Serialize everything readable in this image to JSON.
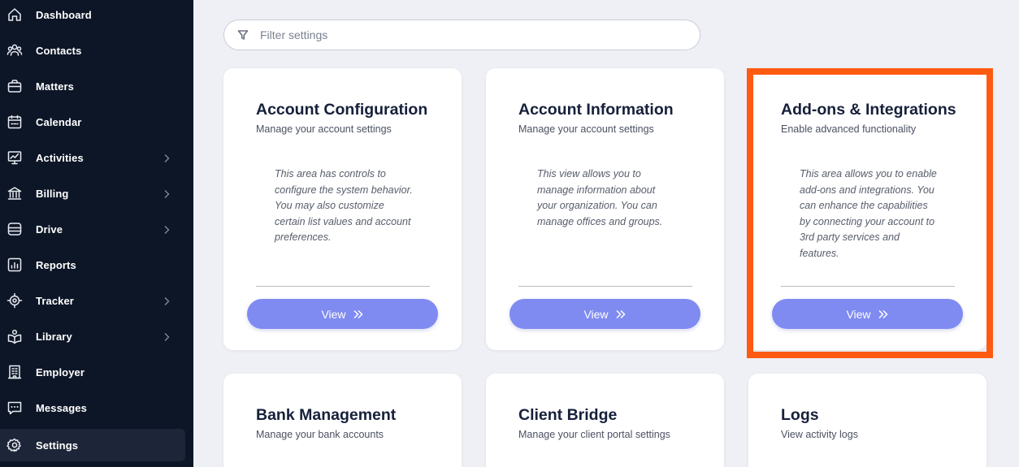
{
  "sidebar": {
    "items": [
      {
        "label": "Dashboard",
        "icon": "home-icon",
        "chevron": false
      },
      {
        "label": "Contacts",
        "icon": "contacts-icon",
        "chevron": false
      },
      {
        "label": "Matters",
        "icon": "briefcase-icon",
        "chevron": false
      },
      {
        "label": "Calendar",
        "icon": "calendar-icon",
        "chevron": false
      },
      {
        "label": "Activities",
        "icon": "activities-icon",
        "chevron": true
      },
      {
        "label": "Billing",
        "icon": "bank-icon",
        "chevron": true
      },
      {
        "label": "Drive",
        "icon": "database-icon",
        "chevron": true
      },
      {
        "label": "Reports",
        "icon": "reports-icon",
        "chevron": false
      },
      {
        "label": "Tracker",
        "icon": "tracker-icon",
        "chevron": true
      },
      {
        "label": "Library",
        "icon": "library-icon",
        "chevron": true
      },
      {
        "label": "Employer",
        "icon": "building-icon",
        "chevron": false
      },
      {
        "label": "Messages",
        "icon": "message-icon",
        "chevron": false
      },
      {
        "label": "Settings",
        "icon": "gear-icon",
        "chevron": false,
        "active": true
      }
    ]
  },
  "filter": {
    "placeholder": "Filter settings",
    "icon": "filter-icon"
  },
  "cards": [
    {
      "title": "Account Configuration",
      "subtitle": "Manage your account settings",
      "description": "This area has controls to configure the system behavior. You may also customize certain list values and account preferences.",
      "button": "View"
    },
    {
      "title": "Account Information",
      "subtitle": "Manage your account settings",
      "description": "This view allows you to manage information about your organization. You can manage offices and groups.",
      "button": "View"
    },
    {
      "title": "Add-ons & Integrations",
      "subtitle": "Enable advanced functionality",
      "description": "This area allows you to enable add-ons and integrations. You can enhance the capabilities by connecting your account to 3rd party services and features.",
      "button": "View"
    },
    {
      "title": "Bank Management",
      "subtitle": "Manage your bank accounts"
    },
    {
      "title": "Client Bridge",
      "subtitle": "Manage your client portal settings"
    },
    {
      "title": "Logs",
      "subtitle": "View activity logs"
    }
  ],
  "colors": {
    "sidebar_bg": "#0d1627",
    "accent_button": "#7f8bf1",
    "highlight": "#ff5a12",
    "page_bg": "#eef0f5"
  }
}
